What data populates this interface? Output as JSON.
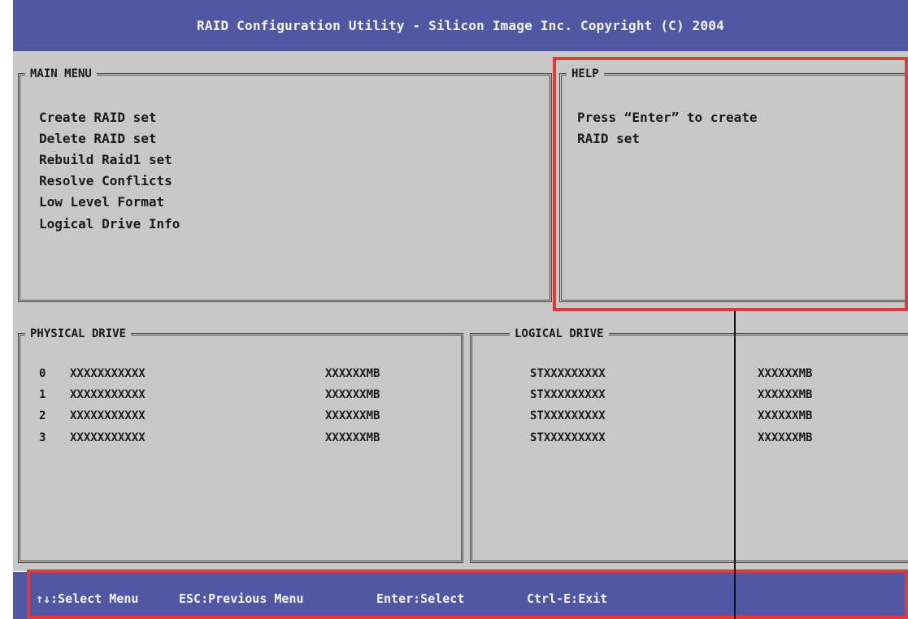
{
  "title": "RAID Configuration Utility - Silicon Image Inc. Copyright (C) 2004",
  "main_menu": {
    "heading": "MAIN MENU",
    "items": [
      "Create RAID set",
      "Delete RAID set",
      "Rebuild Raid1 set",
      "Resolve Conflicts",
      "Low Level Format",
      "Logical Drive Info"
    ]
  },
  "help": {
    "heading": "HELP",
    "lines": [
      "Press “Enter” to create",
      "RAID set"
    ]
  },
  "physical_drive": {
    "heading": "PHYSICAL DRIVE",
    "rows": [
      {
        "index": "0",
        "model": "XXXXXXXXXXX",
        "size": "XXXXXXMB"
      },
      {
        "index": "1",
        "model": "XXXXXXXXXXX",
        "size": "XXXXXXMB"
      },
      {
        "index": "2",
        "model": "XXXXXXXXXXX",
        "size": "XXXXXXMB"
      },
      {
        "index": "3",
        "model": "XXXXXXXXXXX",
        "size": "XXXXXXMB"
      }
    ]
  },
  "logical_drive": {
    "heading": "LOGICAL DRIVE",
    "rows": [
      {
        "name": "STXXXXXXXXX",
        "size": "XXXXXXMB"
      },
      {
        "name": "STXXXXXXXXX",
        "size": "XXXXXXMB"
      },
      {
        "name": "STXXXXXXXXX",
        "size": "XXXXXXMB"
      },
      {
        "name": "STXXXXXXXXX",
        "size": "XXXXXXMB"
      }
    ]
  },
  "status_bar": {
    "select_menu": "↑↓:Select Menu",
    "previous_menu": "ESC:Previous Menu",
    "select": "Enter:Select",
    "exit": "Ctrl-E:Exit"
  },
  "colors": {
    "bar": "#5058a4",
    "panel": "#c8c8c8",
    "highlight": "#e03a3a"
  }
}
